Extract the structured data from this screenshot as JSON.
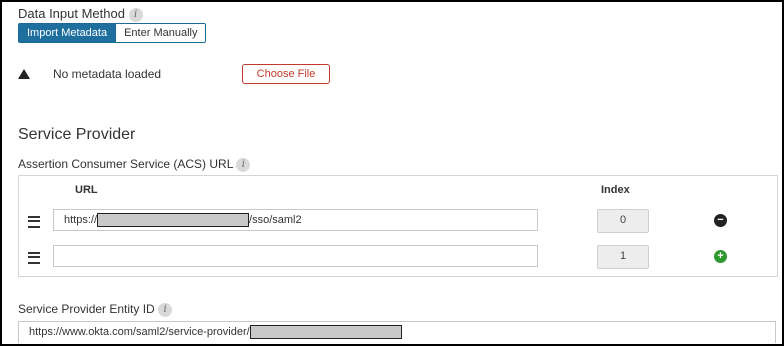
{
  "data_input": {
    "label": "Data Input Method",
    "info": "i",
    "tabs": [
      {
        "label": "Import Metadata",
        "active": true
      },
      {
        "label": "Enter Manually",
        "active": false
      }
    ]
  },
  "metadata": {
    "status": "No metadata loaded",
    "choose_file": "Choose File",
    "warning_icon": "warning-triangle-icon"
  },
  "service_provider": {
    "title": "Service Provider",
    "acs_label": "Assertion Consumer Service (ACS) URL",
    "table": {
      "headers": {
        "url": "URL",
        "index": "Index"
      },
      "rows": [
        {
          "url_prefix": "https://",
          "url_suffix": "/sso/saml2",
          "index": "0",
          "action": "remove"
        },
        {
          "url_prefix": "",
          "url_suffix": "",
          "index": "1",
          "action": "add"
        }
      ]
    },
    "entity_label": "Service Provider Entity ID",
    "entity_value": "https://www.okta.com/saml2/service-provider/"
  },
  "colors": {
    "accent": "#1f6f9e",
    "danger": "#c0392b",
    "add": "#2e9a2e",
    "remove": "#222222"
  },
  "icons": {
    "info": "info-icon",
    "drag": "drag-handle-icon",
    "remove": "minus-circle-icon",
    "add": "plus-circle-icon"
  }
}
